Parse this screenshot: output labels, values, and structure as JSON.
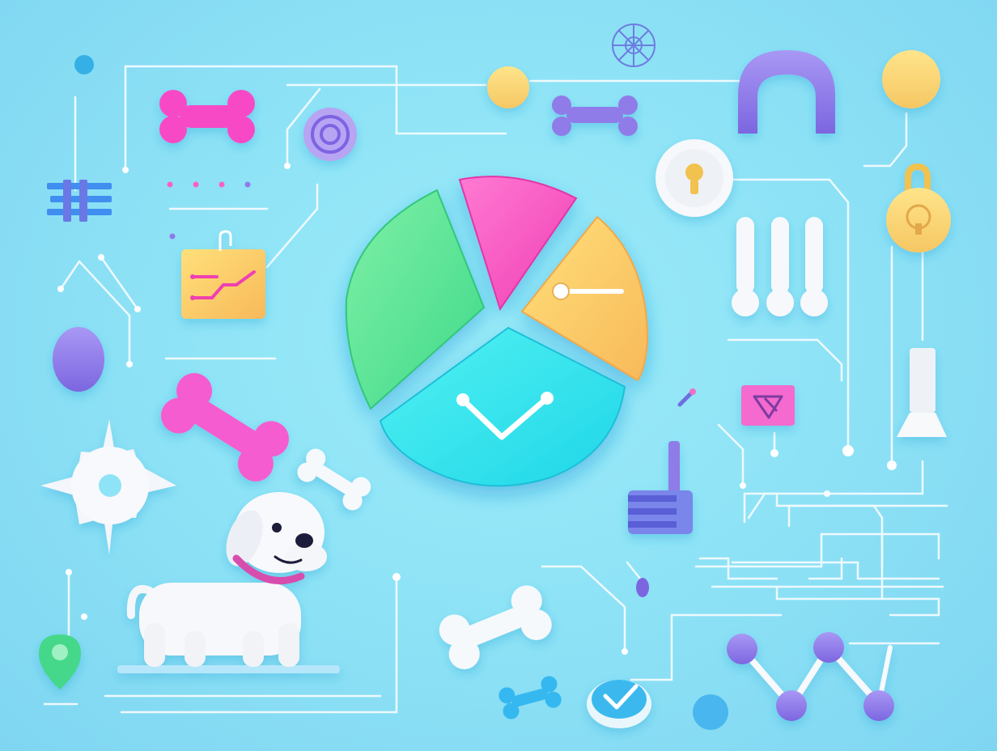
{
  "scene": {
    "background_color": "#8fe3f6",
    "accent_colors": {
      "green": "#5de89a",
      "pink": "#ff5fc8",
      "yellow": "#ffd35c",
      "cyan": "#2fe6ee",
      "purple": "#8f7be8",
      "white": "#f6f9fc",
      "line": "#f2fbff"
    },
    "icons": [
      "pie-chart-icon",
      "dog-icon",
      "bone-icon",
      "gear-icon",
      "clipboard-icon",
      "lightbulb-icon",
      "lock-icon",
      "location-pin-icon",
      "checkmark-icon",
      "arch-icon",
      "circuit-lines",
      "node-graph-icon"
    ],
    "pie_chart": {
      "slices_shown": 4,
      "slice_colors": [
        "#ffd35c",
        "#2fe6ee",
        "#5de89a",
        "#ff5fc8"
      ]
    }
  }
}
